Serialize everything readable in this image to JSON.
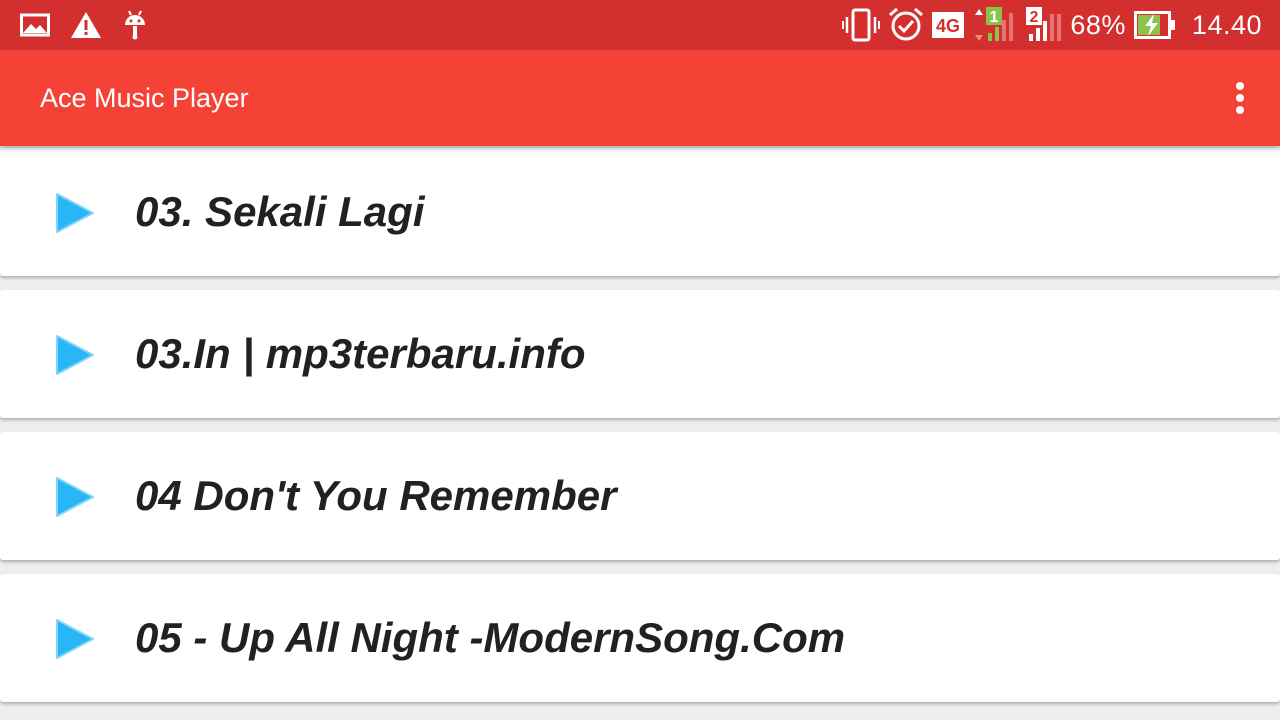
{
  "status_bar": {
    "left_icons": [
      "gallery-icon",
      "warning-icon",
      "android-icon"
    ],
    "right_icons": [
      "vibrate-icon",
      "alarm-icon",
      "network-4g-icon",
      "signal-sim1-icon",
      "signal-sim2-icon",
      "battery-charging-icon"
    ],
    "network_label": "4G",
    "sim1_label": "1",
    "sim2_label": "2",
    "battery_percent": "68%",
    "time": "14.40",
    "background_color": "#d32f2f"
  },
  "app_bar": {
    "title": "Ace Music Player",
    "menu_icon": "more-vert-icon",
    "background_color": "#f44336"
  },
  "songs": [
    {
      "title": "03. Sekali Lagi",
      "icon": "play-icon"
    },
    {
      "title": "03.In | mp3terbaru.info",
      "icon": "play-icon"
    },
    {
      "title": "04 Don't You Remember",
      "icon": "play-icon"
    },
    {
      "title": "05 - Up All Night -ModernSong.Com",
      "icon": "play-icon"
    }
  ],
  "colors": {
    "accent": "#29b6f6",
    "list_background": "#eeeeee",
    "card_background": "#ffffff",
    "text_primary": "#212121"
  }
}
